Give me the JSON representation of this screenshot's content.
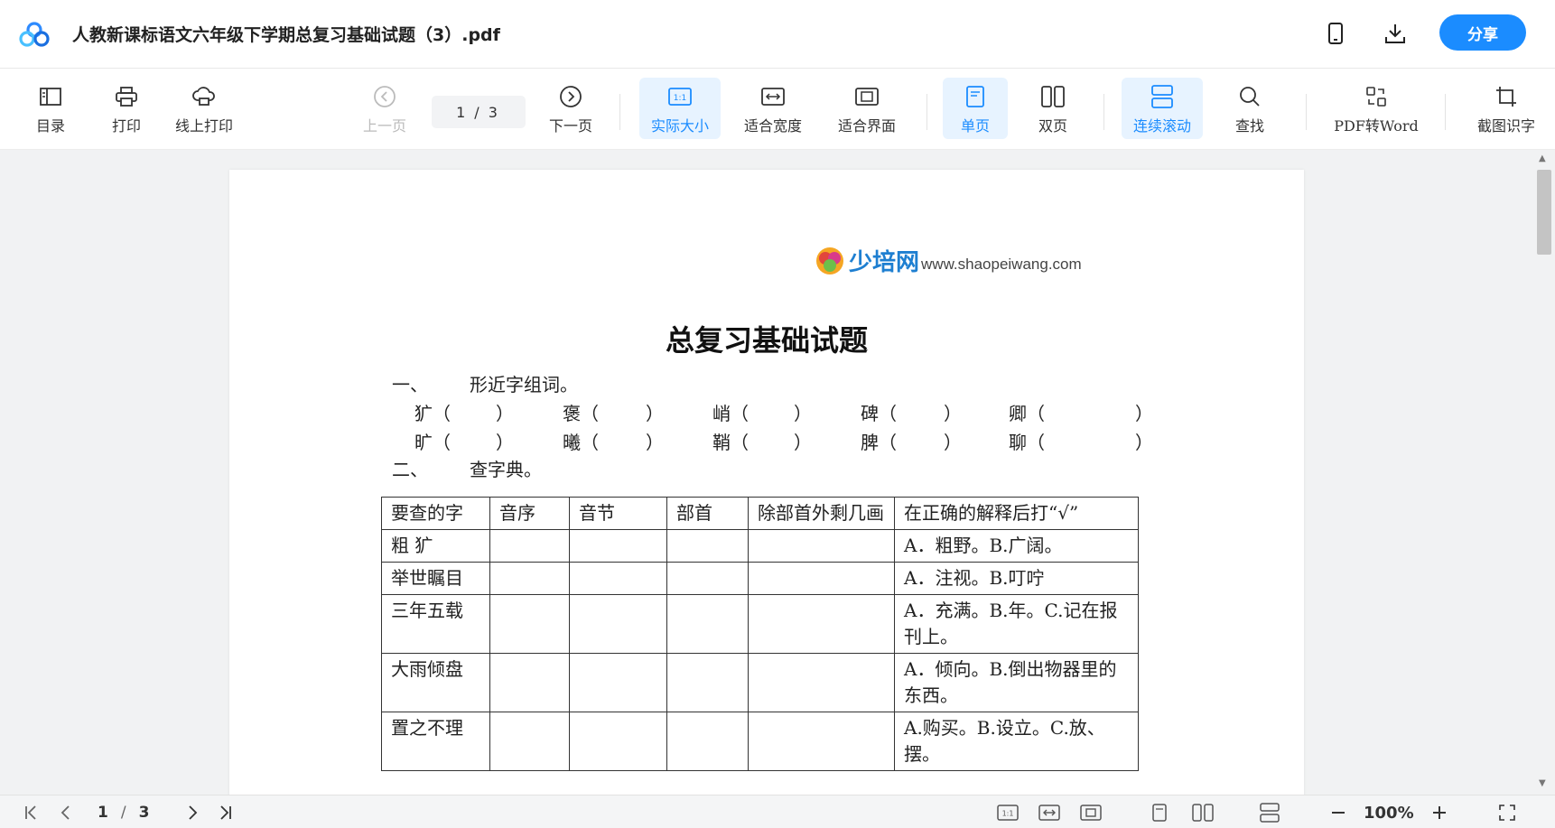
{
  "header": {
    "title": "人教新课标语文六年级下学期总复习基础试题（3）.pdf",
    "share_label": "分享",
    "icons": [
      "mobile-icon",
      "download-icon"
    ]
  },
  "toolbar": {
    "catalog_label": "目录",
    "print_label": "打印",
    "online_print_label": "线上打印",
    "prev_label": "上一页",
    "page_current": "1",
    "page_sep": "/",
    "page_total": "3",
    "next_label": "下一页",
    "actual_size_label": "实际大小",
    "fit_width_label": "适合宽度",
    "fit_page_label": "适合界面",
    "single_label": "单页",
    "double_label": "双页",
    "continuous_label": "连续滚动",
    "find_label": "查找",
    "pdf2word_label": "PDF转Word",
    "ocr_label": "截图识字",
    "actual_size_icon_text": "1:1"
  },
  "document": {
    "watermark_brand": "少培网",
    "watermark_url": "www.shaopeiwang.com",
    "title": "总复习基础试题",
    "q1": {
      "num": "一、",
      "text": "形近字组词。"
    },
    "q1_rows": [
      [
        "犷（",
        "）",
        "褒（",
        "）",
        "峭（",
        "）",
        "碑（",
        "）",
        "卿（",
        "）"
      ],
      [
        "旷（",
        "）",
        "曦（",
        "）",
        "鞘（",
        "）",
        "脾（",
        "）",
        "聊（",
        "）"
      ]
    ],
    "q2": {
      "num": "二、",
      "text": "查字典。"
    },
    "table_header": [
      "要查的字",
      "音序",
      "音节",
      "部首",
      "除部首外剩几画",
      "在正确的解释后打“√”"
    ],
    "table_rows": [
      {
        "word": "粗 犷",
        "meaning": "A．粗野。B.广阔。"
      },
      {
        "word": "举世瞩目",
        "meaning": "A．注视。B.叮咛"
      },
      {
        "word": "三年五载",
        "meaning": "A．充满。B.年。C.记在报刊上。"
      },
      {
        "word": "大雨倾盘",
        "meaning": "A．倾向。B.倒出物器里的东西。"
      },
      {
        "word": "置之不理",
        "meaning": "A.购买。B.设立。C.放、摆。"
      }
    ]
  },
  "statusbar": {
    "page_current": "1",
    "page_sep": "/",
    "page_total": "3",
    "zoom": "100%",
    "actual_size_icon_text": "1:1"
  },
  "colors": {
    "accent": "#1b8cff",
    "active_bg": "#e7f3ff",
    "viewer_bg": "#f1f2f3"
  }
}
